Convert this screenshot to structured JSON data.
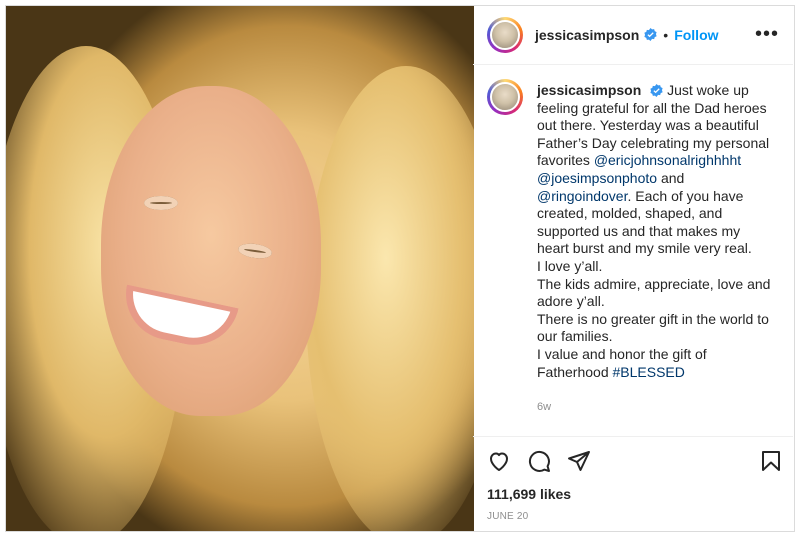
{
  "post": {
    "username": "jessicasimpson",
    "follow_label": "Follow",
    "dot": "•",
    "more": "•••",
    "caption_lines": [
      "Just woke up",
      "feeling grateful for all the Dad heroes",
      "out there. Yesterday was a beautiful",
      "Father’s Day celebrating my personal"
    ],
    "caption_favorites": "favorites",
    "mention1": "@ericjohnsonalrighhhht",
    "mention2": "@joesimpsonphoto",
    "and": "and",
    "mention3": "@ringoindover",
    "caption_rest1": ". Each of you have",
    "caption_body": [
      "created, molded, shaped, and",
      "supported us and that makes my",
      "heart burst and my smile very real.",
      "I love y’all.",
      "The kids admire, appreciate, love and",
      "adore y’all.",
      "There is no greater gift in the world to",
      "our families.",
      "I value and honor the gift of"
    ],
    "caption_end": "Fatherhood",
    "hashtag": "#BLESSED",
    "age": "6w",
    "likes": "111,699 likes",
    "date": "JUNE 20"
  },
  "colors": {
    "accent": "#0095f6",
    "link": "#00376b",
    "text": "#262626",
    "muted": "#8e8e8e"
  },
  "icons": [
    "heart-icon",
    "comment-icon",
    "share-icon",
    "bookmark-icon",
    "verified-icon",
    "more-icon"
  ]
}
